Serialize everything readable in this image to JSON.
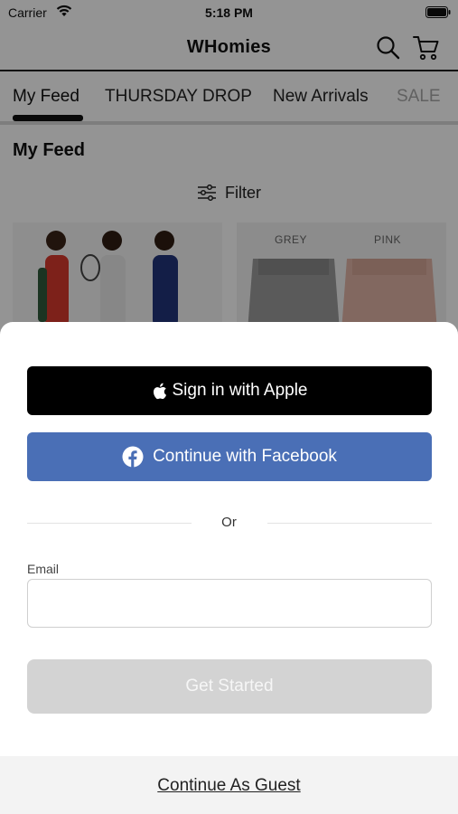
{
  "status_bar": {
    "carrier": "Carrier",
    "time": "5:18 PM"
  },
  "header": {
    "title": "WHomies"
  },
  "tabs": [
    {
      "label": "My Feed",
      "active": true
    },
    {
      "label": "THURSDAY DROP"
    },
    {
      "label": "New Arrivals"
    },
    {
      "label": "SALE"
    }
  ],
  "feed": {
    "section_title": "My Feed",
    "filter_label": "Filter",
    "product_labels": [
      "GREY",
      "PINK"
    ]
  },
  "auth": {
    "apple_label": "Sign in with Apple",
    "facebook_label": "Continue with Facebook",
    "or_label": "Or",
    "email_label": "Email",
    "email_value": "",
    "email_placeholder": "",
    "get_started_label": "Get Started",
    "guest_label": "Continue As Guest"
  },
  "colors": {
    "facebook": "#4a6fb6",
    "apple": "#000000",
    "disabled_button": "#d3d3d3"
  }
}
